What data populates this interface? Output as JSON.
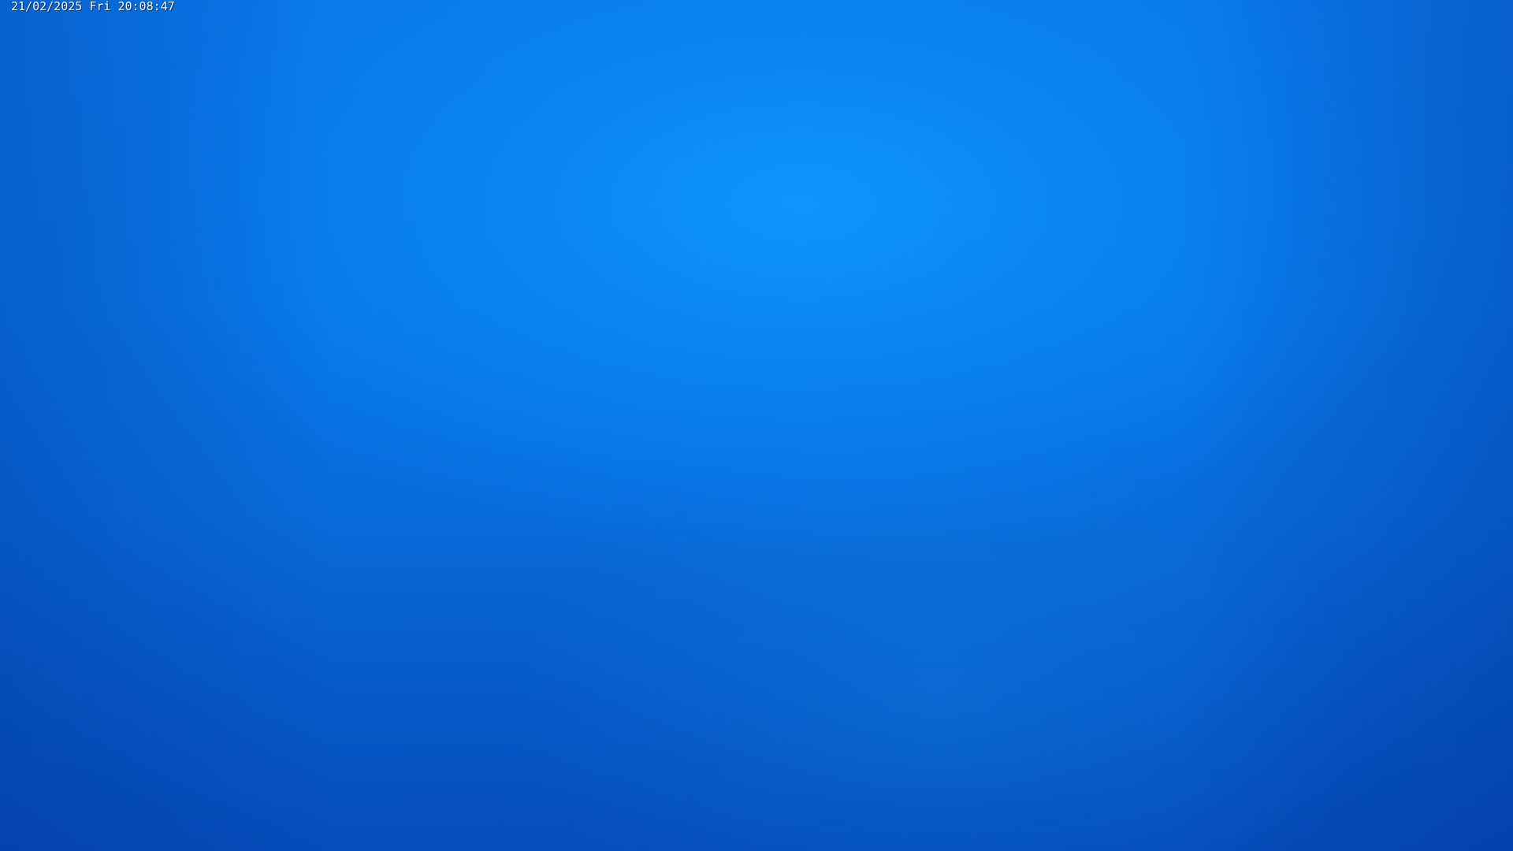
{
  "overlay": {
    "timestamp": "21/02/2025 Fri 20:08:47"
  },
  "scene": {
    "dominant_color": "#0a78ea"
  }
}
